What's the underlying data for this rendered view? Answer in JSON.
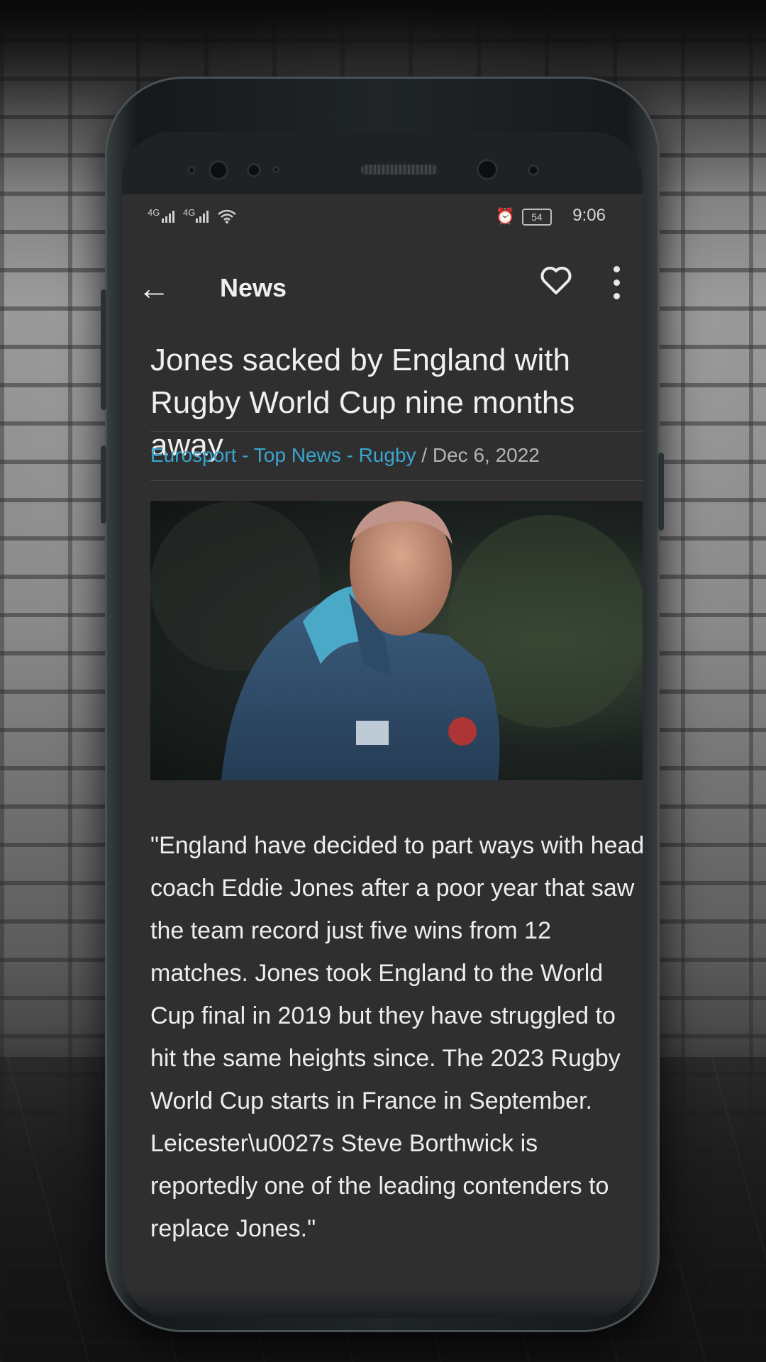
{
  "status": {
    "signal1": "4G",
    "signal2": "4G",
    "battery": "54",
    "time": "9:06"
  },
  "appbar": {
    "title": "News",
    "icons": [
      "back-arrow-icon",
      "heart-icon",
      "more-vert-icon"
    ]
  },
  "article": {
    "headline": "Jones sacked by England with Rugby World Cup nine months away",
    "source": "Eurosport - Top News - Rugby",
    "separator": " / ",
    "date": "Dec 6, 2022",
    "body": "\"England have decided to part ways with head coach Eddie Jones after a poor year that saw the team record just five wins from 12 matches. Jones took England to the World Cup final in 2019 but they have struggled to hit the same heights since. The 2023 Rugby World Cup starts in France in September. Leicester\\u0027s Steve Borthwick is reportedly one of the leading contenders to replace Jones.\""
  },
  "colors": {
    "screen_bg": "#2f2f30",
    "source_link": "#3aa5cf",
    "text": "#ededed"
  }
}
